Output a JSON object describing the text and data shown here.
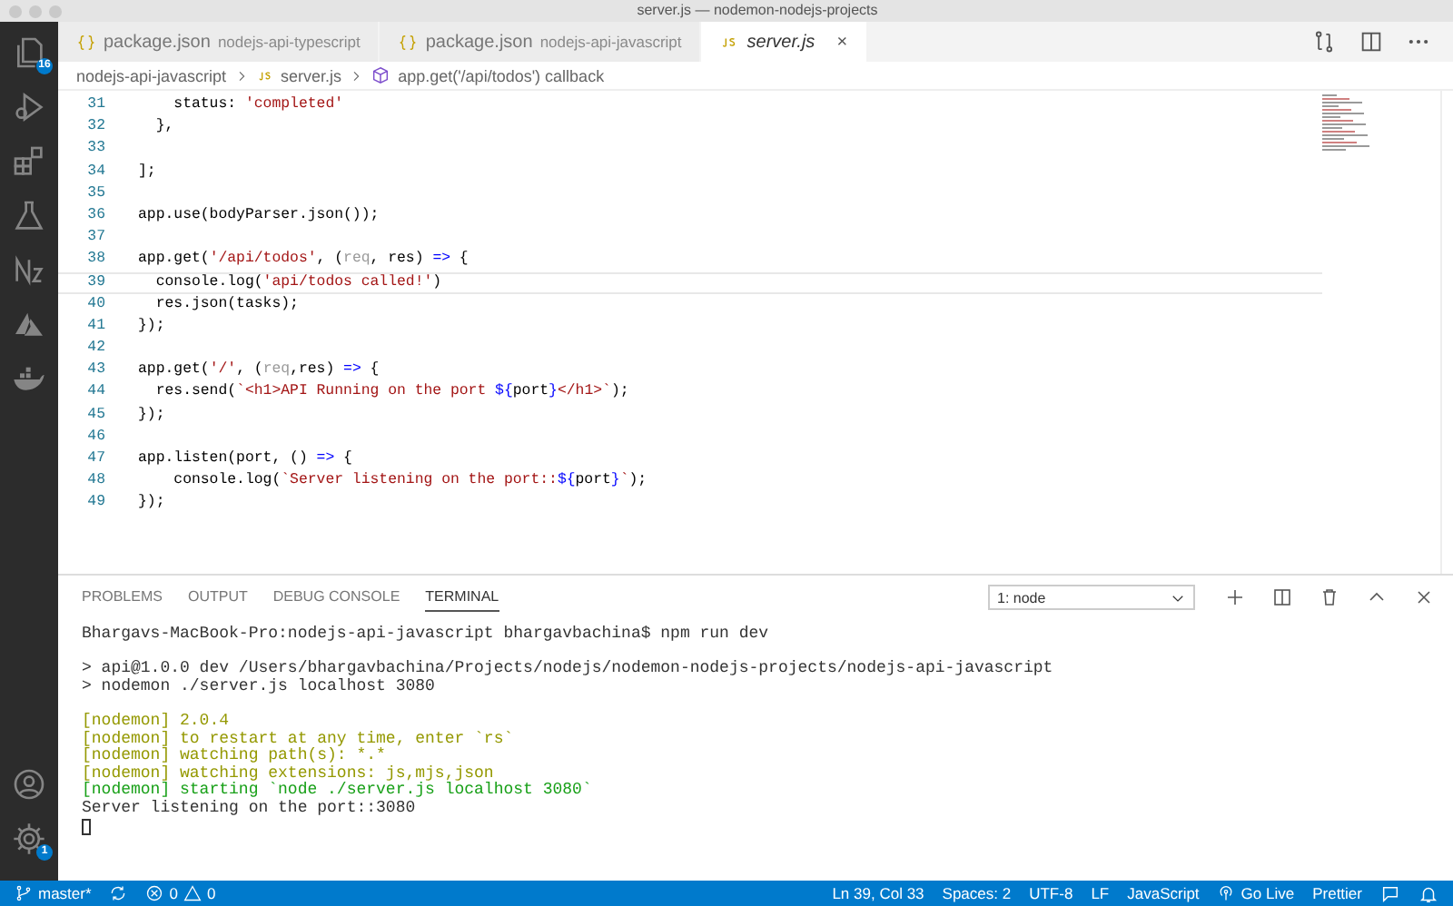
{
  "window": {
    "title": "server.js — nodemon-nodejs-projects"
  },
  "activity_bar": {
    "items": [
      {
        "kind": "files",
        "badge": "16",
        "selected": false
      },
      {
        "kind": "debug",
        "selected": false
      },
      {
        "kind": "extensions",
        "selected": false
      },
      {
        "kind": "flask",
        "selected": false
      },
      {
        "kind": "n2",
        "selected": false
      },
      {
        "kind": "azure",
        "selected": false
      },
      {
        "kind": "docker",
        "selected": false
      }
    ],
    "bottom_items": [
      {
        "kind": "account"
      },
      {
        "kind": "gear",
        "badge": "1"
      }
    ]
  },
  "tabs": [
    {
      "file": "package.json",
      "folder": "nodejs-api-typescript",
      "kind": "json",
      "selected": false
    },
    {
      "file": "package.json",
      "folder": "nodejs-api-javascript",
      "kind": "json",
      "selected": false
    },
    {
      "file": "server.js",
      "kind": "js",
      "selected": true,
      "close": "×"
    }
  ],
  "tab_actions": [
    {
      "kind": "compare"
    },
    {
      "kind": "split"
    },
    {
      "kind": "more"
    }
  ],
  "breadcrumb": [
    {
      "text": "nodejs-api-javascript",
      "kind": "folder"
    },
    {
      "text": "server.js",
      "kind": "js"
    },
    {
      "text": "app.get('/api/todos') callback",
      "kind": "symbol"
    }
  ],
  "code": [
    {
      "number": "31",
      "current": false,
      "tokens": [
        {
          "t": "    status: ",
          "kind": "plain"
        },
        {
          "t": "'completed'",
          "kind": "string"
        }
      ]
    },
    {
      "number": "32",
      "current": false,
      "tokens": [
        {
          "t": "  },",
          "kind": "plain"
        }
      ]
    },
    {
      "number": "33",
      "current": false
    },
    {
      "number": "34",
      "current": false,
      "tokens": [
        {
          "t": "];",
          "kind": "plain"
        }
      ]
    },
    {
      "number": "35",
      "current": false
    },
    {
      "number": "36",
      "current": false,
      "tokens": [
        {
          "t": "app.use(bodyParser.json());",
          "kind": "plain"
        }
      ]
    },
    {
      "number": "37",
      "current": false
    },
    {
      "number": "38",
      "current": false,
      "tokens": [
        {
          "t": "app.get(",
          "kind": "plain"
        },
        {
          "t": "'/api/todos'",
          "kind": "string"
        },
        {
          "t": ", (",
          "kind": "plain"
        },
        {
          "t": "req",
          "kind": "param"
        },
        {
          "t": ", res) ",
          "kind": "plain"
        },
        {
          "t": "=>",
          "kind": "keyword"
        },
        {
          "t": " {",
          "kind": "plain"
        }
      ]
    },
    {
      "number": "39",
      "current": true,
      "tokens": [
        {
          "t": "  console.log(",
          "kind": "plain"
        },
        {
          "t": "'api/todos called!'",
          "kind": "string"
        },
        {
          "t": ")",
          "kind": "plain"
        }
      ]
    },
    {
      "number": "40",
      "current": false,
      "tokens": [
        {
          "t": "  res.json(tasks);",
          "kind": "plain"
        }
      ]
    },
    {
      "number": "41",
      "current": false,
      "tokens": [
        {
          "t": "});",
          "kind": "plain"
        }
      ]
    },
    {
      "number": "42",
      "current": false
    },
    {
      "number": "43",
      "current": false,
      "tokens": [
        {
          "t": "app.get(",
          "kind": "plain"
        },
        {
          "t": "'/'",
          "kind": "string"
        },
        {
          "t": ", (",
          "kind": "plain"
        },
        {
          "t": "req",
          "kind": "param"
        },
        {
          "t": ",res) ",
          "kind": "plain"
        },
        {
          "t": "=>",
          "kind": "keyword"
        },
        {
          "t": " {",
          "kind": "plain"
        }
      ]
    },
    {
      "number": "44",
      "current": false,
      "tokens": [
        {
          "t": "  res.send(",
          "kind": "plain"
        },
        {
          "t": "`<h1>API Running on the port ",
          "kind": "string"
        },
        {
          "t": "${",
          "kind": "keyword"
        },
        {
          "t": "port",
          "kind": "plain"
        },
        {
          "t": "}",
          "kind": "keyword"
        },
        {
          "t": "</h1>`",
          "kind": "string"
        },
        {
          "t": ");",
          "kind": "plain"
        }
      ]
    },
    {
      "number": "45",
      "current": false,
      "tokens": [
        {
          "t": "});",
          "kind": "plain"
        }
      ]
    },
    {
      "number": "46",
      "current": false
    },
    {
      "number": "47",
      "current": false,
      "tokens": [
        {
          "t": "app.listen(port, () ",
          "kind": "plain"
        },
        {
          "t": "=>",
          "kind": "keyword"
        },
        {
          "t": " {",
          "kind": "plain"
        }
      ]
    },
    {
      "number": "48",
      "current": false,
      "tokens": [
        {
          "t": "    console.log(",
          "kind": "plain"
        },
        {
          "t": "`Server listening on the port::",
          "kind": "string"
        },
        {
          "t": "${",
          "kind": "keyword"
        },
        {
          "t": "port",
          "kind": "plain"
        },
        {
          "t": "}",
          "kind": "keyword"
        },
        {
          "t": "`",
          "kind": "string"
        },
        {
          "t": ");",
          "kind": "plain"
        }
      ]
    },
    {
      "number": "49",
      "current": false,
      "tokens": [
        {
          "t": "});",
          "kind": "plain"
        }
      ]
    }
  ],
  "panel": {
    "tabs": [
      {
        "label": "PROBLEMS",
        "selected": false
      },
      {
        "label": "OUTPUT",
        "selected": false
      },
      {
        "label": "DEBUG CONSOLE",
        "selected": false
      },
      {
        "label": "TERMINAL",
        "selected": true
      }
    ],
    "terminal_select": "1: node",
    "actions": [
      {
        "kind": "add"
      },
      {
        "kind": "split"
      },
      {
        "kind": "trash"
      },
      {
        "kind": "maximize"
      },
      {
        "kind": "close"
      }
    ],
    "lines": [
      {
        "text": "Bhargavs-MacBook-Pro:nodejs-api-javascript bhargavbachina$ npm run dev",
        "kind": "plain"
      },
      {
        "kind": "blank"
      },
      {
        "text": "> api@1.0.0 dev /Users/bhargavbachina/Projects/nodejs/nodemon-nodejs-projects/nodejs-api-javascript",
        "kind": "plain"
      },
      {
        "text": "> nodemon ./server.js localhost 3080",
        "kind": "plain"
      },
      {
        "kind": "blank"
      },
      {
        "text": "[nodemon] 2.0.4",
        "kind": "info"
      },
      {
        "text": "[nodemon] to restart at any time, enter `rs`",
        "kind": "info"
      },
      {
        "text": "[nodemon] watching path(s): *.*",
        "kind": "info"
      },
      {
        "text": "[nodemon] watching extensions: js,mjs,json",
        "kind": "info"
      },
      {
        "text": "[nodemon] starting `node ./server.js localhost 3080`",
        "kind": "success"
      },
      {
        "text": "Server listening on the port::3080",
        "kind": "plain"
      },
      {
        "kind": "cursor"
      }
    ]
  },
  "status_bar": {
    "left": [
      {
        "kind": "branch",
        "text": "master*"
      },
      {
        "kind": "sync"
      },
      {
        "kind": "problems",
        "errors": "0",
        "warnings": "0"
      }
    ],
    "right": [
      {
        "kind": "text",
        "text": "Ln 39, Col 33"
      },
      {
        "kind": "text",
        "text": "Spaces: 2"
      },
      {
        "kind": "text",
        "text": "UTF-8"
      },
      {
        "kind": "text",
        "text": "LF"
      },
      {
        "kind": "text",
        "text": "JavaScript"
      },
      {
        "kind": "golive",
        "text": "Go Live"
      },
      {
        "kind": "text",
        "text": "Prettier"
      },
      {
        "kind": "feedback"
      },
      {
        "kind": "bell"
      }
    ]
  }
}
